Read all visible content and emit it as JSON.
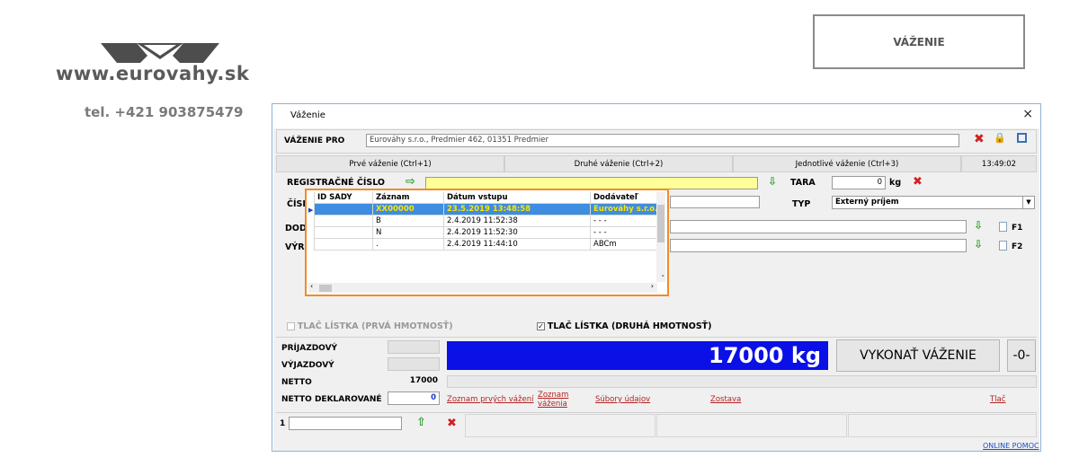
{
  "brand": {
    "site": "www.eurovahy.sk",
    "phone": "tel. +421 903875479",
    "logo_color": "#4d4d4d"
  },
  "header_button": {
    "label": "VÁŽENIE"
  },
  "window": {
    "title": "Váženie",
    "close_glyph": "×",
    "vazenie_pro": {
      "label": "VÁŽENIE PRO",
      "value": "Eurováhy s.r.o., Predmier  462, 01351 Predmier"
    },
    "tabs": [
      {
        "label": "Prvé váženie (Ctrl+1)"
      },
      {
        "label": "Druhé váženie (Ctrl+2)"
      },
      {
        "label": "Jednotlivé váženie (Ctrl+3)"
      }
    ],
    "clock": "13:49:02",
    "reg": {
      "label": "REGISTRAČNÉ ČÍSLO",
      "value": ""
    },
    "cislo_label": "ČÍSL",
    "dod_label": "DOD",
    "vyr_label": "VÝR",
    "tara": {
      "label": "TARA",
      "value": "0",
      "unit": "kg"
    },
    "typ": {
      "label": "TYP",
      "value": "Externý príjem"
    },
    "f1": "F1",
    "f2": "F2",
    "grid": {
      "columns": [
        "ID SADY",
        "Záznam",
        "Dátum vstupu",
        "Dodávateľ"
      ],
      "rows": [
        {
          "id": "",
          "zaznam": "XX00000",
          "datum": "23.5.2019 13:48:58",
          "dod": "Eurováhy s.r.o."
        },
        {
          "id": "",
          "zaznam": "B",
          "datum": "2.4.2019 11:52:38",
          "dod": "- - -"
        },
        {
          "id": "",
          "zaznam": "N",
          "datum": "2.4.2019 11:52:30",
          "dod": "- - -"
        },
        {
          "id": "",
          "zaznam": ".",
          "datum": "2.4.2019 11:44:10",
          "dod": "ABCm"
        }
      ]
    },
    "tlac1": {
      "label": "TLAČ LÍSTKA (PRVÁ HMOTNOSŤ)",
      "checked": false
    },
    "tlac2": {
      "label": "TLAČ LÍSTKA (DRUHÁ HMOTNOSŤ)",
      "checked": true
    },
    "weights": {
      "prijazdovy": {
        "label": "PRÍJAZDOVÝ",
        "value": ""
      },
      "vyjazdovy": {
        "label": "VÝJAZDOVÝ",
        "value": ""
      },
      "netto": {
        "label": "NETTO",
        "value": "17000"
      },
      "netto_dekl": {
        "label": "NETTO DEKLAROVANÉ",
        "value": "0"
      }
    },
    "display": "17000 kg",
    "vykonat": "VYKONAŤ VÁŽENIE",
    "zero": "-0-",
    "links": {
      "zoznam_prvych": "Zoznam prvých vážení",
      "zoznam_vazenia_1": "Zoznam",
      "zoznam_vazenia_2": "váženia",
      "subory": "Súbory údajov",
      "zostava": "Zostava",
      "tlac": "Tlač"
    },
    "footer": {
      "counter": "1",
      "counter_value": ""
    },
    "online_pomoc": "ONLINE POMOC"
  }
}
